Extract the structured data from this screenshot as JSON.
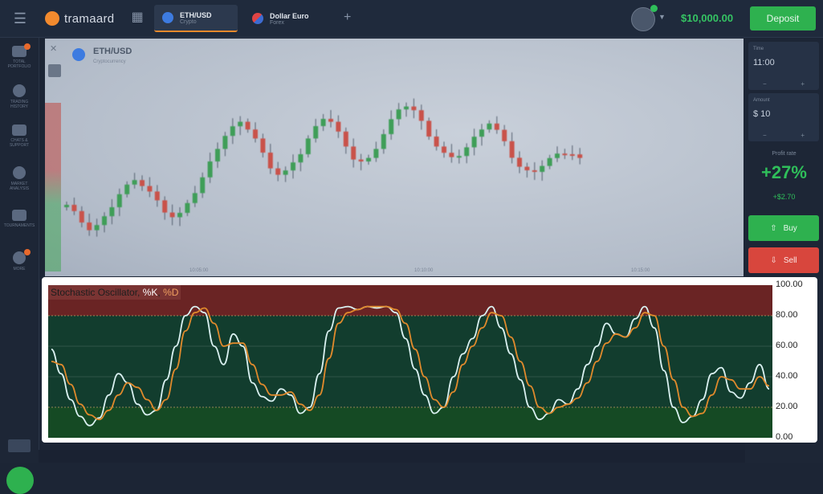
{
  "topbar": {
    "logo_text": "tramaard",
    "tabs": [
      {
        "name": "ETH/USD",
        "sub": "Crypto",
        "active": true
      },
      {
        "name": "Dollar Euro",
        "sub": "Forex",
        "active": false
      }
    ],
    "add_tab": "+",
    "balance": "$10,000.00",
    "deposit_label": "Deposit"
  },
  "sidebar": {
    "items": [
      {
        "label": "TOTAL PORTFOLIO",
        "icon": "portfolio-icon",
        "badge": true
      },
      {
        "label": "TRADING HISTORY",
        "icon": "history-icon",
        "badge": false
      },
      {
        "label": "CHATS & SUPPORT",
        "icon": "chat-icon",
        "badge": false
      },
      {
        "label": "MARKET ANALYSIS",
        "icon": "analysis-icon",
        "badge": false
      },
      {
        "label": "TOURNAMENTS",
        "icon": "tournament-icon",
        "badge": false
      },
      {
        "label": "MORE",
        "icon": "more-icon",
        "badge": true
      }
    ]
  },
  "chart": {
    "pair": "ETH/USD",
    "pair_sub": "Cryptocurrency",
    "close": "✕",
    "time_labels": [
      "10:05:00",
      "10:10:00",
      "10:15:00"
    ]
  },
  "right_panel": {
    "time_label": "Time",
    "time_value": "11:00",
    "amount_label": "Amount",
    "amount_value": "$ 10",
    "profit_label": "Profit rate",
    "profit_pct": "+27%",
    "profit_amt": "+$2.70",
    "buy_label": "Buy",
    "sell_label": "Sell"
  },
  "oscillator": {
    "title_prefix": "Stochastic Oscillator, ",
    "title_k": "%K",
    "title_sep": ", ",
    "title_d": "%D",
    "y_ticks": [
      "100.00",
      "80.00",
      "60.00",
      "40.00",
      "20.00",
      "0.00"
    ],
    "colors": {
      "overbought": "#6a2424",
      "neutral": "#123d2e",
      "oversold": "#154a24",
      "k_line": "#d9f0f0",
      "d_line": "#e08a2c"
    }
  },
  "chart_data": {
    "type": "line",
    "title": "Stochastic Oscillator",
    "ylim": [
      0,
      100
    ],
    "series": [
      {
        "name": "%K",
        "values": [
          58,
          42,
          25,
          14,
          8,
          13,
          28,
          42,
          36,
          22,
          15,
          18,
          38,
          60,
          80,
          86,
          82,
          60,
          48,
          68,
          60,
          36,
          27,
          24,
          32,
          28,
          16,
          20,
          42,
          70,
          85,
          86,
          84,
          86,
          85,
          86,
          82,
          65,
          45,
          28,
          16,
          20,
          40,
          55,
          65,
          80,
          86,
          72,
          55,
          38,
          20,
          12,
          16,
          25,
          22,
          32,
          48,
          60,
          75,
          68,
          66,
          78,
          86,
          72,
          44,
          20,
          10,
          14,
          25,
          42,
          46,
          30,
          26,
          36,
          48,
          32
        ]
      },
      {
        "name": "%D",
        "values": [
          50,
          48,
          35,
          22,
          15,
          12,
          18,
          28,
          36,
          33,
          25,
          18,
          25,
          45,
          70,
          82,
          85,
          75,
          60,
          62,
          62,
          48,
          35,
          28,
          28,
          30,
          22,
          18,
          28,
          52,
          75,
          82,
          84,
          86,
          86,
          86,
          84,
          75,
          58,
          40,
          25,
          20,
          30,
          48,
          60,
          72,
          82,
          80,
          66,
          50,
          34,
          20,
          16,
          20,
          22,
          26,
          36,
          50,
          62,
          68,
          66,
          72,
          82,
          80,
          60,
          38,
          20,
          14,
          16,
          28,
          40,
          38,
          32,
          32,
          40,
          34
        ]
      }
    ]
  }
}
